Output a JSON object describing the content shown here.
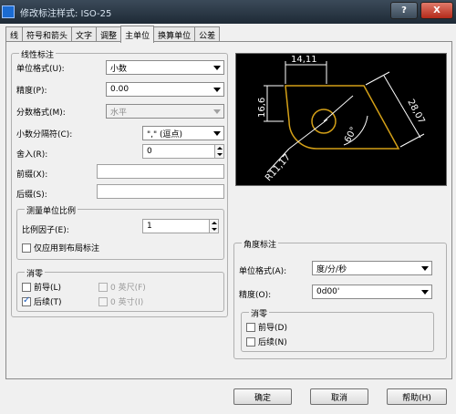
{
  "window": {
    "title": "修改标注样式: ISO-25"
  },
  "titlebar": {
    "help_label": "?",
    "close_label": "X"
  },
  "tabs": [
    {
      "label": "线"
    },
    {
      "label": "符号和箭头"
    },
    {
      "label": "文字"
    },
    {
      "label": "调整"
    },
    {
      "label": "主单位"
    },
    {
      "label": "换算单位"
    },
    {
      "label": "公差"
    }
  ],
  "linear": {
    "title": "线性标注",
    "unit_format": {
      "label": "单位格式(U):",
      "value": "小数"
    },
    "precision": {
      "label": "精度(P):",
      "value": "0.00"
    },
    "fraction_format": {
      "label": "分数格式(M):",
      "value": "水平"
    },
    "decimal_sep": {
      "label": "小数分隔符(C):",
      "value": "\",\" (逗点)"
    },
    "round_off": {
      "label": "舍入(R):",
      "value": "0"
    },
    "prefix": {
      "label": "前缀(X):",
      "value": ""
    },
    "suffix": {
      "label": "后缀(S):",
      "value": ""
    }
  },
  "scale": {
    "title": "测量单位比例",
    "factor_label": "比例因子(E):",
    "factor_value": "1",
    "layout_only_label": "仅应用到布局标注"
  },
  "zero_suppress": {
    "title": "消零",
    "leading": "前导(L)",
    "trailing": "后续(T)",
    "feet": "0 英尺(F)",
    "inches": "0 英寸(I)"
  },
  "preview": {
    "dim_top": "14,11",
    "dim_left": "16,6",
    "dim_right": "28,07",
    "dim_angle": "60°",
    "dim_radius": "R11,17"
  },
  "angular": {
    "title": "角度标注",
    "unit_format": {
      "label": "单位格式(A):",
      "value": "度/分/秒"
    },
    "precision": {
      "label": "精度(O):",
      "value": "0d00'"
    },
    "zero_title": "消零",
    "leading": "前导(D)",
    "trailing": "后续(N)"
  },
  "buttons": {
    "ok": "确定",
    "cancel": "取消",
    "help": "帮助(H)"
  },
  "colors": {
    "preview_bg": "#000000",
    "shape": "#d4a017",
    "dim": "#ffffff"
  }
}
